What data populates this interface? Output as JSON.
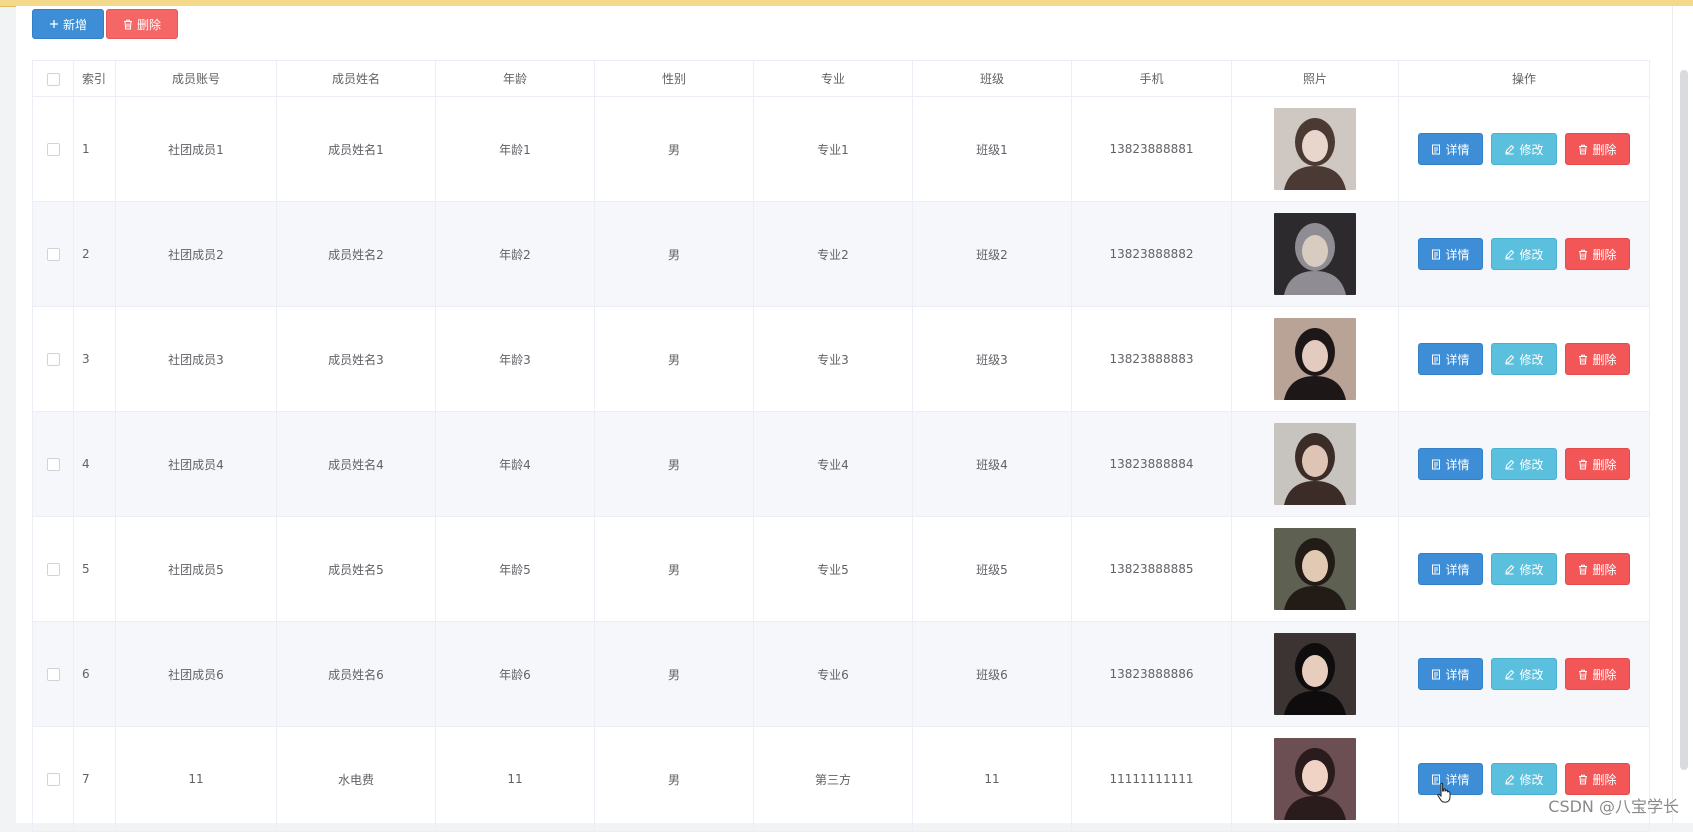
{
  "toolbar": {
    "add_label": "新增",
    "delete_label": "删除"
  },
  "table": {
    "columns": [
      "索引",
      "成员账号",
      "成员姓名",
      "年龄",
      "性别",
      "专业",
      "班级",
      "手机",
      "照片",
      "操作"
    ],
    "rows": [
      {
        "index": "1",
        "account": "社团成员1",
        "name": "成员姓名1",
        "age": "年龄1",
        "gender": "男",
        "major": "专业1",
        "class": "班级1",
        "phone": "13823888881"
      },
      {
        "index": "2",
        "account": "社团成员2",
        "name": "成员姓名2",
        "age": "年龄2",
        "gender": "男",
        "major": "专业2",
        "class": "班级2",
        "phone": "13823888882"
      },
      {
        "index": "3",
        "account": "社团成员3",
        "name": "成员姓名3",
        "age": "年龄3",
        "gender": "男",
        "major": "专业3",
        "class": "班级3",
        "phone": "13823888883"
      },
      {
        "index": "4",
        "account": "社团成员4",
        "name": "成员姓名4",
        "age": "年龄4",
        "gender": "男",
        "major": "专业4",
        "class": "班级4",
        "phone": "13823888884"
      },
      {
        "index": "5",
        "account": "社团成员5",
        "name": "成员姓名5",
        "age": "年龄5",
        "gender": "男",
        "major": "专业5",
        "class": "班级5",
        "phone": "13823888885"
      },
      {
        "index": "6",
        "account": "社团成员6",
        "name": "成员姓名6",
        "age": "年龄6",
        "gender": "男",
        "major": "专业6",
        "class": "班级6",
        "phone": "13823888886"
      },
      {
        "index": "7",
        "account": "11",
        "name": "水电费",
        "age": "11",
        "gender": "男",
        "major": "第三方",
        "class": "11",
        "phone": "11111111111"
      }
    ],
    "actions": {
      "detail_label": "详情",
      "edit_label": "修改",
      "delete_label": "删除"
    }
  },
  "watermark": "CSDN @八宝学长",
  "colors": {
    "primary": "#3d8ed6",
    "info": "#5bc0de",
    "danger": "#f35656",
    "top_bar": "#f5d98b"
  },
  "icons": {
    "add": "plus-icon",
    "delete": "trash-icon",
    "detail": "document-icon",
    "edit": "pencil-icon",
    "checkbox": "checkbox-icon"
  }
}
